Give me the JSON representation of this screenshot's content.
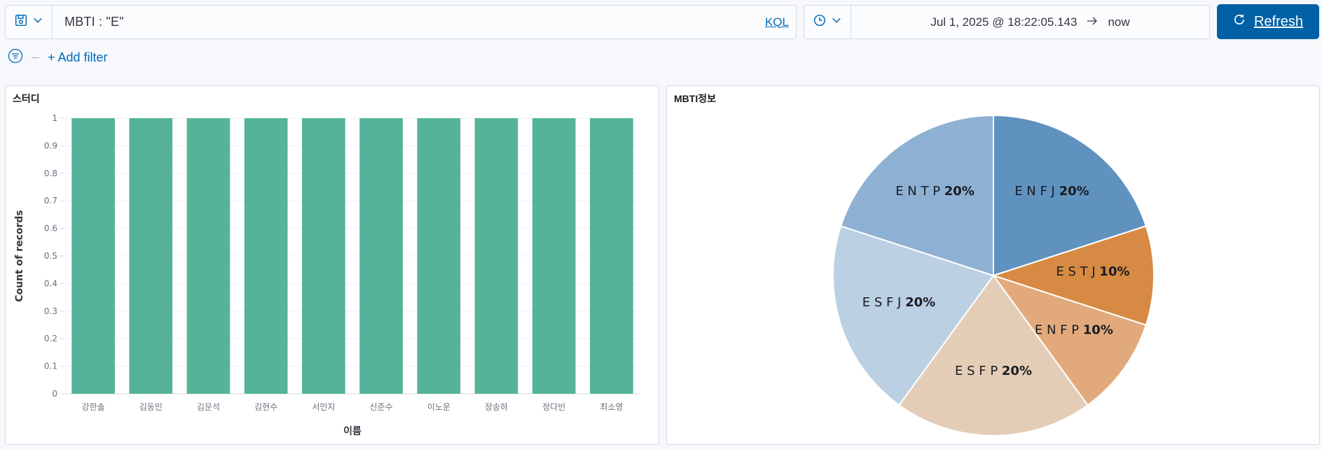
{
  "query_bar": {
    "query": "MBTI : \"E\"",
    "language_label": "KQL",
    "saved_query_icon": "save-icon",
    "dropdown_icon": "chevron-down-icon"
  },
  "time_picker": {
    "start": "Jul 1, 2025 @ 18:22:05.143",
    "end": "now",
    "icon": "clock-icon"
  },
  "refresh": {
    "label": "Refresh",
    "icon": "refresh-icon"
  },
  "filters": {
    "add_label": "+ Add filter",
    "icon": "filter-icon"
  },
  "colors": {
    "bar": "#54b399",
    "accent": "#006bb8",
    "refresh_bg": "#0061a6"
  },
  "panels": {
    "left_title": "스터디",
    "right_title": "MBTI정보"
  },
  "chart_data": [
    {
      "type": "bar",
      "title": "스터디",
      "xlabel": "이름",
      "ylabel": "Count of records",
      "categories": [
        "강한솔",
        "김동민",
        "김문석",
        "김현수",
        "서민지",
        "신준수",
        "이노운",
        "장송하",
        "정다빈",
        "최소영"
      ],
      "values": [
        1,
        1,
        1,
        1,
        1,
        1,
        1,
        1,
        1,
        1
      ],
      "ylim": [
        0,
        1
      ],
      "yticks": [
        "0",
        "0.1",
        "0.2",
        "0.3",
        "0.4",
        "0.5",
        "0.6",
        "0.7",
        "0.8",
        "0.9",
        "1"
      ],
      "grid": true
    },
    {
      "type": "pie",
      "title": "MBTI정보",
      "slices": [
        {
          "label": "E N F J",
          "pct": "20%",
          "value": 20,
          "color": "#6092c0"
        },
        {
          "label": "E S T J",
          "pct": "10%",
          "value": 10,
          "color": "#d68a43"
        },
        {
          "label": "E N F P",
          "pct": "10%",
          "value": 10,
          "color": "#e2aa7c"
        },
        {
          "label": "E S F P",
          "pct": "20%",
          "value": 20,
          "color": "#e4cdb7"
        },
        {
          "label": "E S F J",
          "pct": "20%",
          "value": 20,
          "color": "#bcd0e4"
        },
        {
          "label": "E N T P",
          "pct": "20%",
          "value": 20,
          "color": "#8eb0d3"
        }
      ]
    }
  ]
}
